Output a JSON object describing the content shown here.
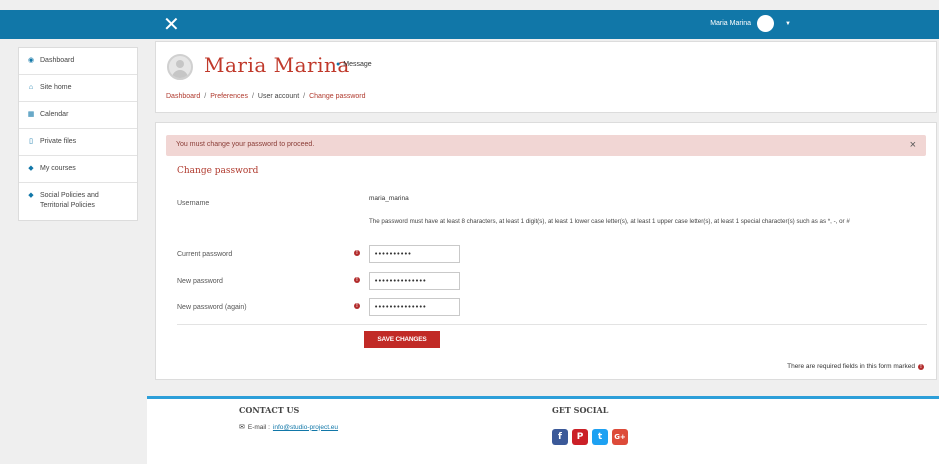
{
  "topbar": {
    "user_name": "Maria Marina"
  },
  "sidebar": {
    "items": [
      {
        "label": "Dashboard"
      },
      {
        "label": "Site home"
      },
      {
        "label": "Calendar"
      },
      {
        "label": "Private files"
      },
      {
        "label": "My courses"
      },
      {
        "label": "Social Policies and Territorial Policies"
      }
    ]
  },
  "header": {
    "name": "Maria Marina",
    "message_label": "Message",
    "breadcrumb": [
      "Dashboard",
      "Preferences",
      "User account",
      "Change password"
    ]
  },
  "alert": {
    "text": "You must change your password to proceed."
  },
  "form": {
    "title": "Change password",
    "username_label": "Username",
    "username_value": "maria_marina",
    "policy_hint": "The password must have at least 8 characters, at least 1 digit(s), at least 1 lower case letter(s), at least 1 upper case letter(s), at least 1 special character(s) such as as *, -, or #",
    "current_label": "Current password",
    "current_value": "••••••••••",
    "new_label": "New password",
    "new_value": "••••••••••••••",
    "new_again_label": "New password (again)",
    "new_again_value": "••••••••••••••",
    "save_label": "SAVE CHANGES",
    "required_note": "There are required fields in this form marked"
  },
  "footer": {
    "contact_heading": "CONTACT US",
    "email_label": "E-mail :",
    "email": "info@studio-project.eu",
    "social_heading": "GET SOCIAL"
  }
}
